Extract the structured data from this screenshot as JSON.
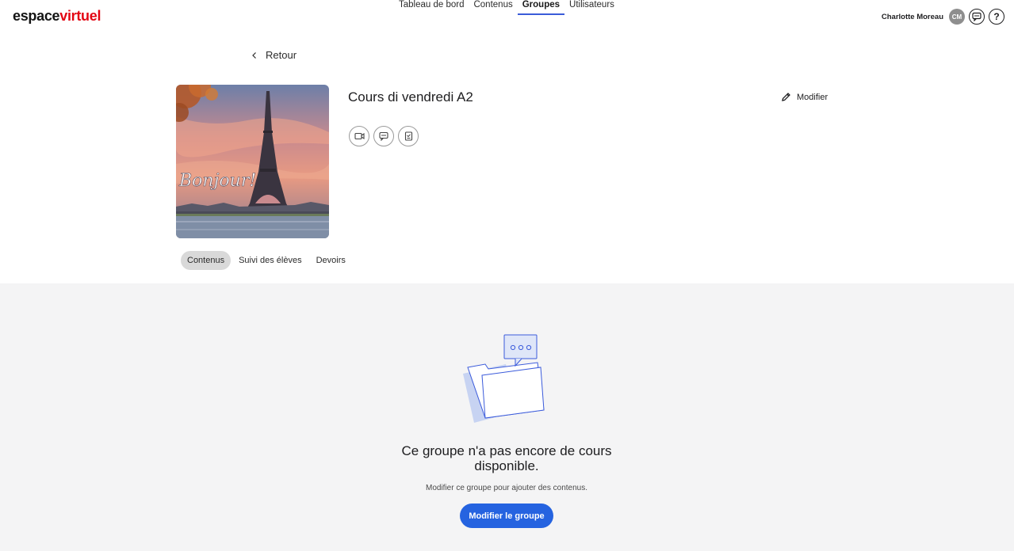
{
  "brand": {
    "part1": "espace",
    "part2": "virtuel",
    "accent": "#e30613"
  },
  "nav": {
    "items": [
      {
        "label": "Tableau de bord"
      },
      {
        "label": "Contenus"
      },
      {
        "label": "Groupes",
        "active": true
      },
      {
        "label": "Utilisateurs"
      }
    ]
  },
  "user": {
    "name": "Charlotte Moreau",
    "initials": "CM",
    "messages_icon": "chat-bubble-icon",
    "help_icon": "question-mark-icon",
    "help_glyph": "?"
  },
  "back": {
    "label": "Retour",
    "icon": "arrow-left-icon"
  },
  "group": {
    "title": "Cours di vendredi A2",
    "cover_text": "Bonjour!",
    "actions": [
      {
        "icon": "video-camera-icon"
      },
      {
        "icon": "chat-bubble-icon"
      },
      {
        "icon": "assignment-icon"
      }
    ],
    "edit_label": "Modifier",
    "edit_icon": "pencil-icon"
  },
  "tabs": [
    {
      "label": "Contenus",
      "active": true
    },
    {
      "label": "Suivi des élèves"
    },
    {
      "label": "Devoirs"
    }
  ],
  "empty_state": {
    "illustration_icon": "folder-chat-illustration-icon",
    "title": "Ce groupe n'a pas encore de cours disponible.",
    "subtitle": "Modifier ce groupe pour ajouter des contenus.",
    "button_label": "Modifier le groupe",
    "button_color": "#2563e0"
  }
}
